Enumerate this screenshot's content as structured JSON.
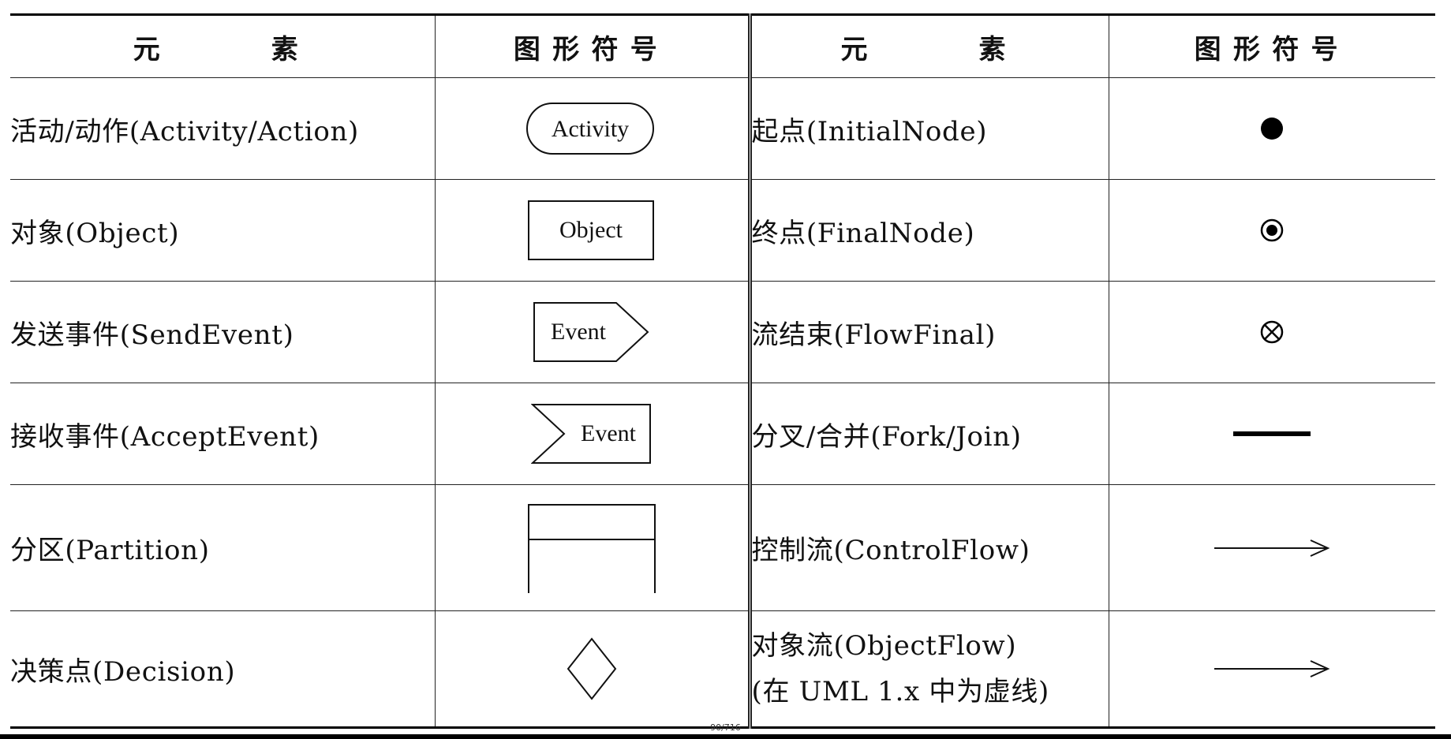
{
  "headers": {
    "element": "元  素",
    "symbol": "图形符号"
  },
  "left_rows": [
    {
      "element": "活动/动作(Activity/Action)",
      "symbol_icon": "activity-rounded-rect",
      "symbol_text": "Activity"
    },
    {
      "element": "对象(Object)",
      "symbol_icon": "object-rect",
      "symbol_text": "Object"
    },
    {
      "element": "发送事件(SendEvent)",
      "symbol_icon": "send-event-pentagon",
      "symbol_text": "Event"
    },
    {
      "element": "接收事件(AcceptEvent)",
      "symbol_icon": "accept-event-notched-rect",
      "symbol_text": "Event"
    },
    {
      "element": "分区(Partition)",
      "symbol_icon": "partition-swimlane"
    },
    {
      "element": "决策点(Decision)",
      "symbol_icon": "decision-diamond"
    }
  ],
  "right_rows": [
    {
      "element": "起点(InitialNode)",
      "symbol_icon": "initial-node-filled-circle"
    },
    {
      "element": "终点(FinalNode)",
      "symbol_icon": "final-node-bullseye"
    },
    {
      "element": "流结束(FlowFinal)",
      "symbol_icon": "flow-final-circled-x"
    },
    {
      "element": "分叉/合并(Fork/Join)",
      "symbol_icon": "fork-join-bar"
    },
    {
      "element": "控制流(ControlFlow)",
      "symbol_icon": "control-flow-arrow"
    },
    {
      "element_line1": "对象流(ObjectFlow)",
      "element_line2": "(在 UML 1.x 中为虚线)",
      "symbol_icon": "object-flow-arrow"
    }
  ],
  "footer": {
    "page_indicator": "90/716"
  }
}
